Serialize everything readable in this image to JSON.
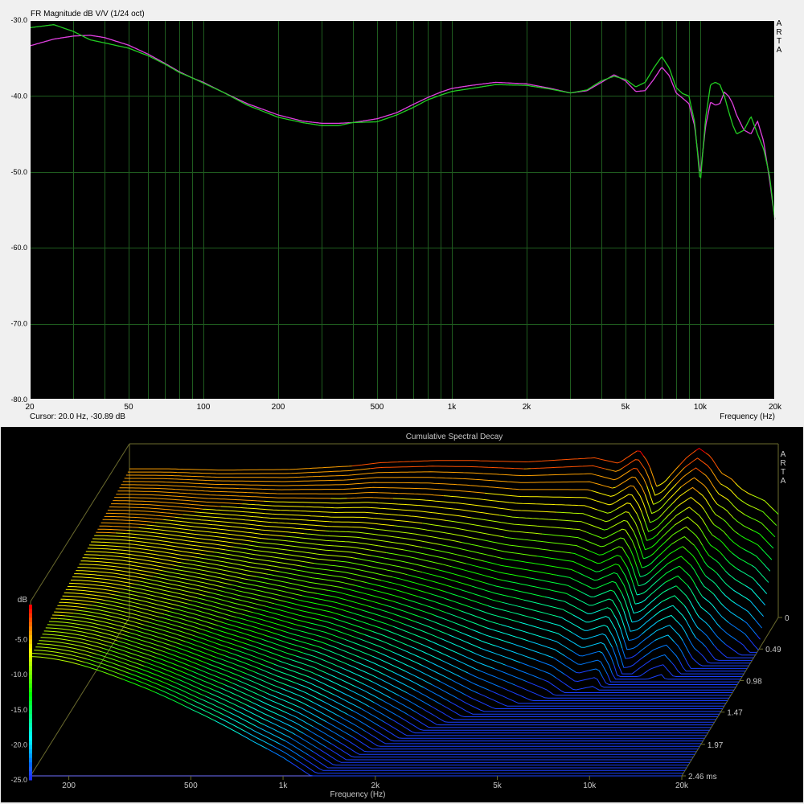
{
  "chart_data": [
    {
      "type": "line",
      "title": "FR Magnitude dB V/V (1/24 oct)",
      "watermark": "ARTA",
      "cursor_text": "Cursor: 20.0 Hz, -30.89 dB",
      "xlabel": "Frequency (Hz)",
      "x_scale": "log",
      "xlim": [
        20,
        20000
      ],
      "ylim": [
        -80,
        -30
      ],
      "x_ticks": [
        {
          "v": 20,
          "label": "20"
        },
        {
          "v": 50,
          "label": "50"
        },
        {
          "v": 100,
          "label": "100"
        },
        {
          "v": 200,
          "label": "200"
        },
        {
          "v": 500,
          "label": "500"
        },
        {
          "v": 1000,
          "label": "1k"
        },
        {
          "v": 2000,
          "label": "2k"
        },
        {
          "v": 5000,
          "label": "5k"
        },
        {
          "v": 10000,
          "label": "10k"
        },
        {
          "v": 20000,
          "label": "20k"
        }
      ],
      "y_ticks": [
        {
          "v": -30,
          "label": "-30.0"
        },
        {
          "v": -40,
          "label": "-40.0"
        },
        {
          "v": -50,
          "label": "-50.0"
        },
        {
          "v": -60,
          "label": "-60.0"
        },
        {
          "v": -70,
          "label": "-70.0"
        },
        {
          "v": -80,
          "label": "-80.0"
        }
      ],
      "grid": true,
      "colors": {
        "background": "#000000",
        "grid": "#1f5c1f",
        "frame": "#ffffff"
      },
      "series": [
        {
          "color": "#e040e0",
          "x": [
            20,
            25,
            30,
            35,
            40,
            50,
            60,
            70,
            80,
            90,
            100,
            120,
            150,
            200,
            250,
            300,
            350,
            400,
            500,
            600,
            700,
            800,
            900,
            1000,
            1200,
            1500,
            2000,
            2500,
            3000,
            3500,
            4000,
            4500,
            5000,
            5500,
            6000,
            6500,
            7000,
            7500,
            8000,
            8500,
            9000,
            9500,
            10000,
            10500,
            11000,
            11500,
            12000,
            12500,
            13000,
            13500,
            14000,
            15000,
            16000,
            17000,
            18000,
            19000,
            20000
          ],
          "y": [
            -33.4,
            -32.5,
            -32.1,
            -32.0,
            -32.3,
            -33.3,
            -34.5,
            -35.7,
            -36.8,
            -37.6,
            -38.2,
            -39.5,
            -41.0,
            -42.5,
            -43.3,
            -43.6,
            -43.6,
            -43.5,
            -43.0,
            -42.2,
            -41.1,
            -40.2,
            -39.5,
            -39.0,
            -38.6,
            -38.2,
            -38.4,
            -39.0,
            -39.6,
            -39.3,
            -38.2,
            -37.2,
            -38.0,
            -39.4,
            -39.3,
            -37.8,
            -36.2,
            -37.3,
            -39.6,
            -40.3,
            -41.0,
            -44.0,
            -50.5,
            -44.0,
            -40.8,
            -41.2,
            -41.0,
            -39.5,
            -40.0,
            -41.0,
            -42.5,
            -44.5,
            -45.0,
            -43.3,
            -46.0,
            -51.0,
            -56.5
          ]
        },
        {
          "color": "#22cc22",
          "x": [
            20,
            25,
            30,
            35,
            40,
            50,
            60,
            70,
            80,
            90,
            100,
            120,
            150,
            200,
            250,
            300,
            350,
            400,
            500,
            600,
            700,
            800,
            900,
            1000,
            1200,
            1500,
            2000,
            2500,
            3000,
            3500,
            4000,
            4500,
            5000,
            5500,
            6000,
            6500,
            7000,
            7500,
            8000,
            8500,
            9000,
            9500,
            10000,
            10500,
            11000,
            11500,
            12000,
            12500,
            13000,
            13500,
            14000,
            15000,
            16000,
            17000,
            18000,
            19000,
            20000
          ],
          "y": [
            -31.0,
            -30.6,
            -31.5,
            -32.6,
            -33.0,
            -33.7,
            -34.7,
            -35.8,
            -36.9,
            -37.6,
            -38.3,
            -39.5,
            -41.2,
            -42.8,
            -43.5,
            -43.9,
            -43.9,
            -43.5,
            -43.4,
            -42.5,
            -41.5,
            -40.5,
            -39.9,
            -39.4,
            -39.0,
            -38.5,
            -38.6,
            -39.1,
            -39.6,
            -39.2,
            -38.0,
            -37.4,
            -37.8,
            -38.8,
            -38.2,
            -36.3,
            -34.8,
            -36.3,
            -38.9,
            -39.7,
            -40.0,
            -43.5,
            -51.5,
            -43.0,
            -38.5,
            -38.2,
            -38.5,
            -40.0,
            -42.0,
            -43.8,
            -45.0,
            -44.5,
            -42.7,
            -45.0,
            -47.0,
            -50.5,
            -56.5
          ]
        }
      ]
    },
    {
      "type": "waterfall",
      "title": "Cumulative Spectral Decay",
      "watermark": "ARTA",
      "xlabel": "Frequency (Hz)",
      "x_scale": "log",
      "xlim": [
        150,
        20000
      ],
      "x_ticks": [
        {
          "v": 200,
          "label": "200"
        },
        {
          "v": 500,
          "label": "500"
        },
        {
          "v": 1000,
          "label": "1k"
        },
        {
          "v": 2000,
          "label": "2k"
        },
        {
          "v": 5000,
          "label": "5k"
        },
        {
          "v": 10000,
          "label": "10k"
        },
        {
          "v": 20000,
          "label": "20k"
        }
      ],
      "zlabel": "dB",
      "zlim": [
        -25,
        0
      ],
      "z_ticks": [
        {
          "v": -5,
          "label": "-5.0"
        },
        {
          "v": -10,
          "label": "-10.0"
        },
        {
          "v": -15,
          "label": "-15.0"
        },
        {
          "v": -20,
          "label": "-20.0"
        },
        {
          "v": -25,
          "label": "-25.0"
        }
      ],
      "time_ticks_ms": [
        {
          "v": 0,
          "label": "0"
        },
        {
          "v": 0.49,
          "label": "0.49"
        },
        {
          "v": 0.98,
          "label": "0.98"
        },
        {
          "v": 1.47,
          "label": "1.47"
        },
        {
          "v": 1.97,
          "label": "1.97"
        },
        {
          "v": 2.46,
          "label": "2.46 ms"
        }
      ],
      "slice_count": 60,
      "colors": {
        "background": "#000000",
        "frame": "#6b6b2e",
        "text": "#c8c8c8"
      },
      "first_slice": {
        "x": [
          200,
          300,
          500,
          800,
          1000,
          1500,
          2000,
          3000,
          5000,
          6000,
          7000,
          7500,
          8000,
          8500,
          9000,
          10000,
          11000,
          12000,
          13000,
          14000,
          15000,
          16000,
          18000,
          20000
        ],
        "y": [
          -3.4,
          -3.6,
          -3.5,
          -3.0,
          -2.5,
          -2.2,
          -2.2,
          -2.4,
          -1.8,
          -2.6,
          -0.6,
          -2.5,
          -6.0,
          -5.3,
          -4.0,
          -1.8,
          -0.4,
          -1.6,
          -4.0,
          -4.8,
          -6.2,
          -7.0,
          -8.0,
          -10.0
        ]
      }
    }
  ]
}
